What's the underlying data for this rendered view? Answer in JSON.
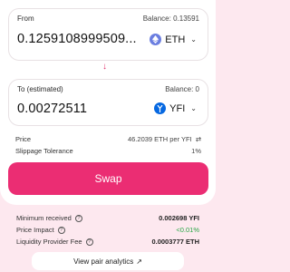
{
  "from": {
    "label": "From",
    "balance": "Balance: 0.13591",
    "amount": "0.1259108999509...",
    "token": "ETH",
    "token_icon": "ethereum-icon"
  },
  "swap_direction_icon": "arrow-down-icon",
  "to": {
    "label": "To (estimated)",
    "balance": "Balance: 0",
    "amount": "0.00272511",
    "token": "YFI",
    "token_icon": "yearn-icon"
  },
  "price": {
    "label": "Price",
    "value": "46.2039 ETH per YFI"
  },
  "slippage": {
    "label": "Slippage Tolerance",
    "value": "1%"
  },
  "swap_button": "Swap",
  "details": {
    "minimum_received": {
      "label": "Minimum received",
      "value": "0.002698 YFI"
    },
    "price_impact": {
      "label": "Price Impact",
      "value": "<0.01%"
    },
    "liquidity_fee": {
      "label": "Liquidity Provider Fee",
      "value": "0.0003777 ETH"
    }
  },
  "pair_analytics": {
    "label": "View pair analytics",
    "arrow": "↗"
  },
  "colors": {
    "accent": "#eb2d73",
    "background": "#fde8ef",
    "positive": "#27a745"
  }
}
